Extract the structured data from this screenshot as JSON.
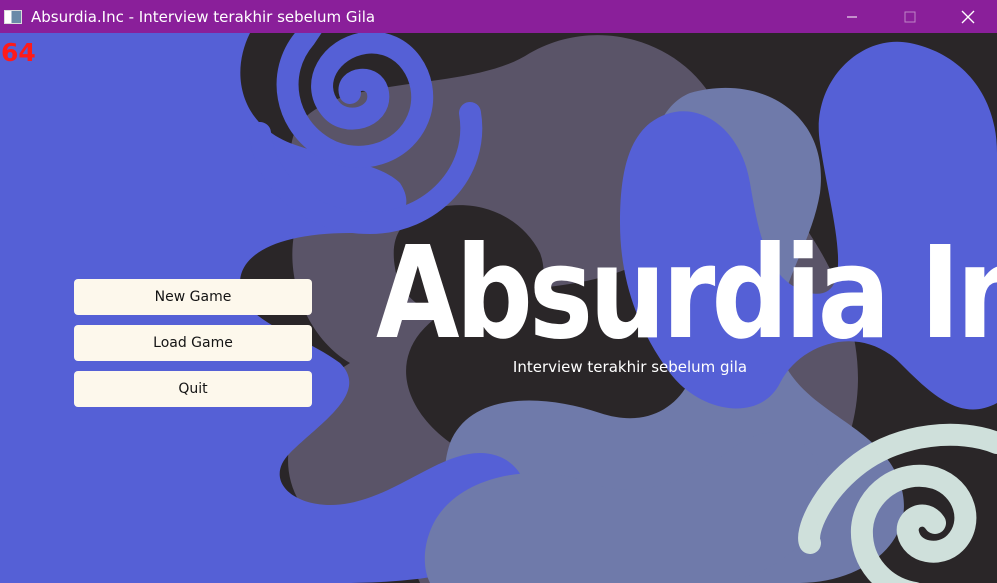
{
  "window": {
    "title": "Absurdia.Inc - Interview terakhir sebelum Gila",
    "icon": "app-window-icon",
    "controls": {
      "minimize_icon": "minimize-icon",
      "maximize_icon": "maximize-icon",
      "close_icon": "close-icon"
    }
  },
  "hud": {
    "fps": "64"
  },
  "title_screen": {
    "title": "Absurdia Inc",
    "subtitle": "Interview terakhir sebelum gila"
  },
  "menu": {
    "items": [
      {
        "label": "New Game"
      },
      {
        "label": "Load Game"
      },
      {
        "label": "Quit"
      }
    ]
  },
  "colors": {
    "titlebar": "#8a1f9a",
    "background_dark": "#2a2628",
    "blob_blue": "#5560d6",
    "blob_slate": "#6f7aaa",
    "blob_gray": "#5a5468",
    "spiral_light": "#cfe0db",
    "button_bg": "#fdf8ec",
    "fps_text": "#ff1a1a"
  }
}
